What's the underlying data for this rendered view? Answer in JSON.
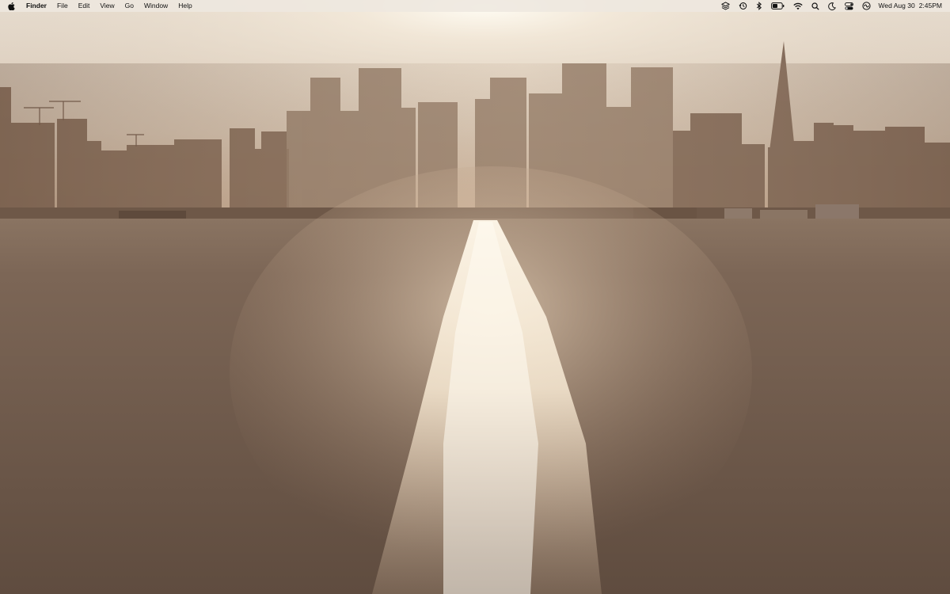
{
  "menubar": {
    "apple_icon": "apple-logo-icon",
    "app_name": "Finder",
    "menus": [
      "File",
      "Edit",
      "View",
      "Go",
      "Window",
      "Help"
    ],
    "status_icons": [
      "layers-icon",
      "time-machine-icon",
      "bluetooth-icon",
      "battery-icon",
      "wifi-icon",
      "search-icon",
      "focus-moon-icon",
      "control-center-icon",
      "siri-icon"
    ],
    "date": "Wed Aug 30",
    "time": "2:45PM"
  },
  "wallpaper": {
    "description_colors": {
      "sky": "#d9cdbf",
      "sun": "#fffaf0",
      "skyline": "#7a6350",
      "water": "#6f5a4a"
    }
  }
}
